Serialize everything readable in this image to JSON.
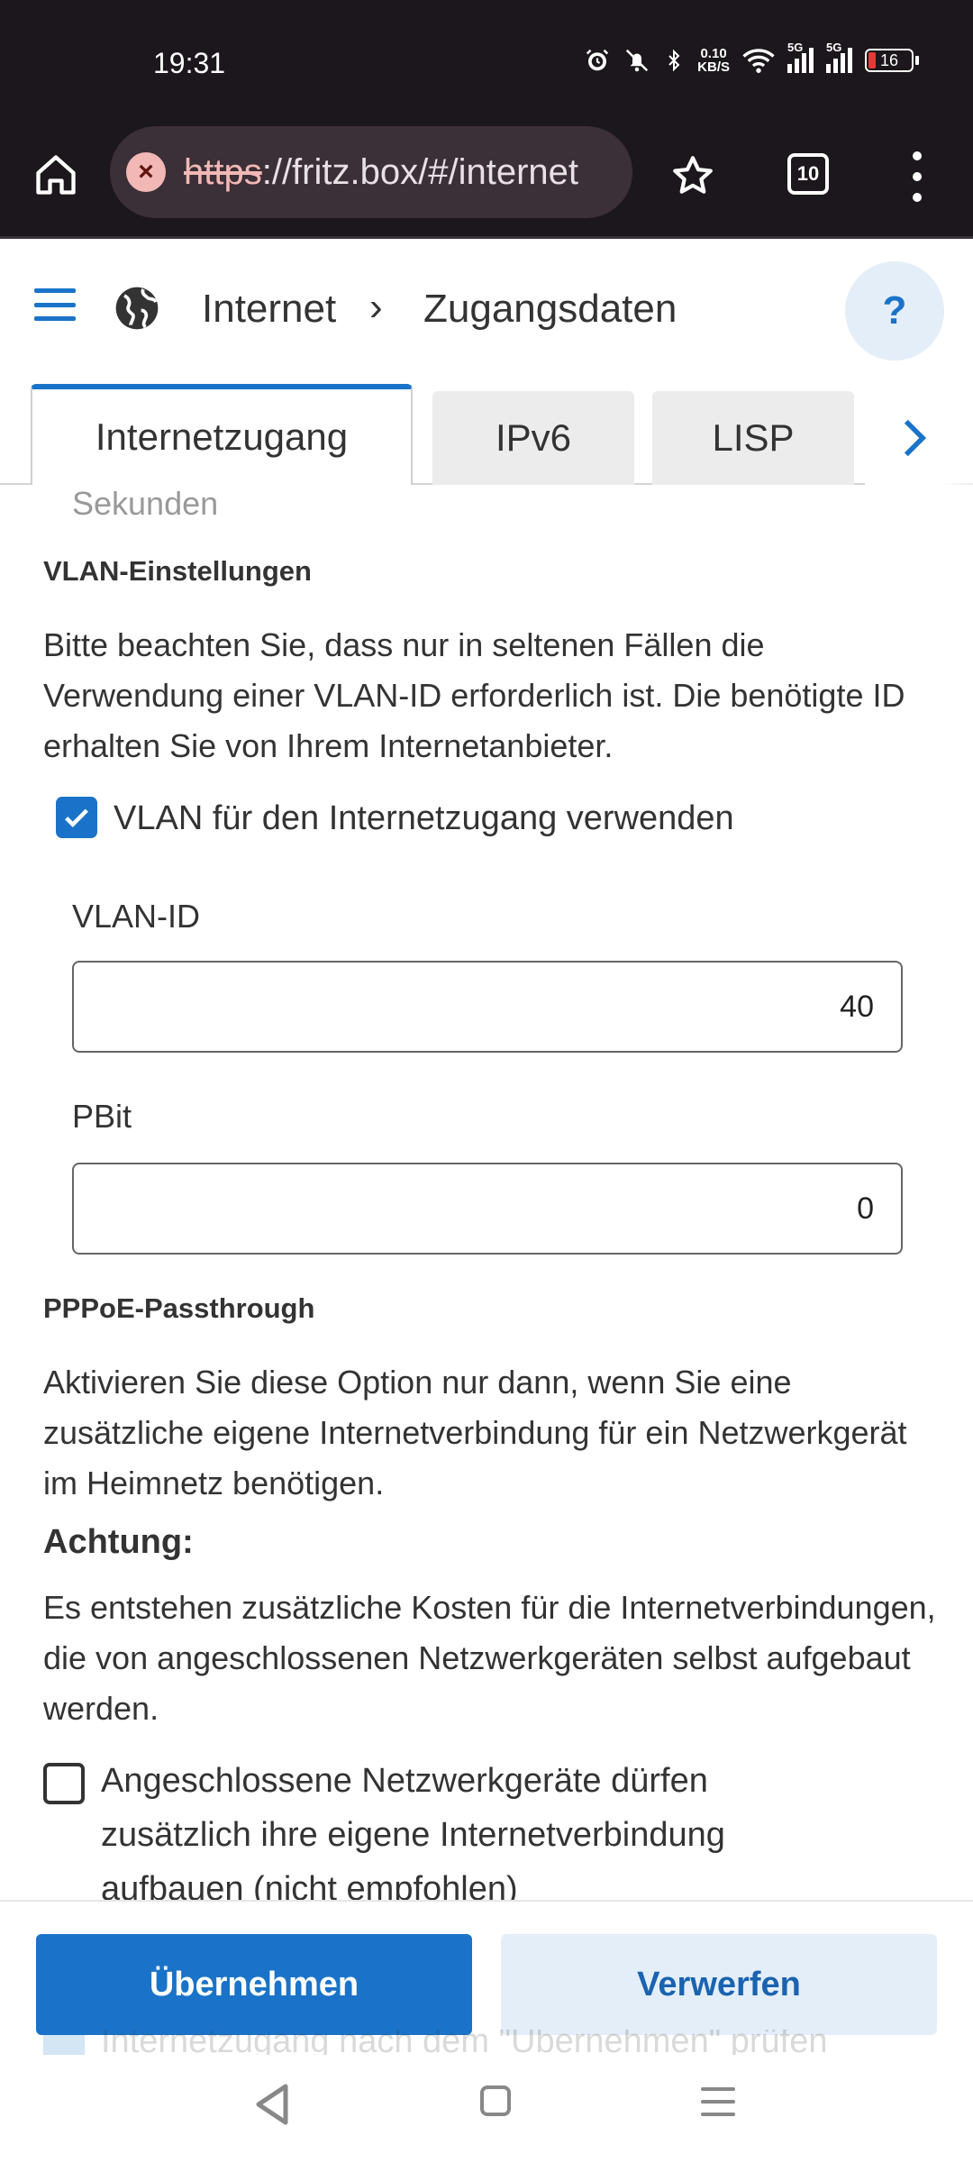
{
  "status_bar": {
    "time": "19:31",
    "net_speed_value": "0.10",
    "net_speed_unit": "KB/S",
    "signal1_label": "5G",
    "signal2_label": "5G",
    "battery": "16",
    "icons": [
      "alarm-icon",
      "mute-icon",
      "bluetooth-icon",
      "wifi-icon",
      "signal-icon",
      "signal-icon",
      "battery-icon"
    ]
  },
  "browser": {
    "url_scheme": "https",
    "url_rest": "://fritz.box/#/internet",
    "tab_count": "10"
  },
  "header": {
    "breadcrumb_section": "Internet",
    "breadcrumb_separator": "›",
    "breadcrumb_page": "Zugangsdaten",
    "help_label": "?"
  },
  "tabs": [
    {
      "label": "Internetzugang",
      "active": true
    },
    {
      "label": "IPv6",
      "active": false
    },
    {
      "label": "LISP",
      "active": false
    }
  ],
  "content": {
    "cut_off_text": "Sekunden",
    "vlan": {
      "heading": "VLAN-Einstellungen",
      "description": "Bitte beachten Sie, dass nur in seltenen Fällen die Verwendung einer VLAN-ID erforderlich ist. Die benötigte ID erhalten Sie von Ihrem Internetanbieter.",
      "checkbox_label": "VLAN für den Internetzugang verwenden",
      "checkbox_checked": true,
      "vlan_id_label": "VLAN-ID",
      "vlan_id_value": "40",
      "pbit_label": "PBit",
      "pbit_value": "0"
    },
    "pppoe": {
      "heading": "PPPoE-Passthrough",
      "description": "Aktivieren Sie diese Option nur dann, wenn Sie eine zusätzliche eigene Internetverbindung für ein Netzwerkgerät im Heimnetz benötigen.",
      "attention_heading": "Achtung:",
      "attention_text": "Es entstehen zusätzliche Kosten für die Internetverbindungen, die von angeschlossenen Netzwerkgeräten selbst aufgebaut werden.",
      "checkbox_label": "Angeschlossene Netzwerkgeräte dürfen zusätzlich ihre eigene Internetverbindung aufbauen (nicht empfohlen)",
      "checkbox_checked": false
    },
    "hidden_behind_bar": "Internetzugang nach dem \"Übernehmen\" prüfen"
  },
  "actions": {
    "apply_label": "Übernehmen",
    "discard_label": "Verwerfen"
  },
  "colors": {
    "accent": "#1a73c8",
    "secondary_button_bg": "#e4eef8",
    "system_bar_bg": "#1c171c"
  }
}
